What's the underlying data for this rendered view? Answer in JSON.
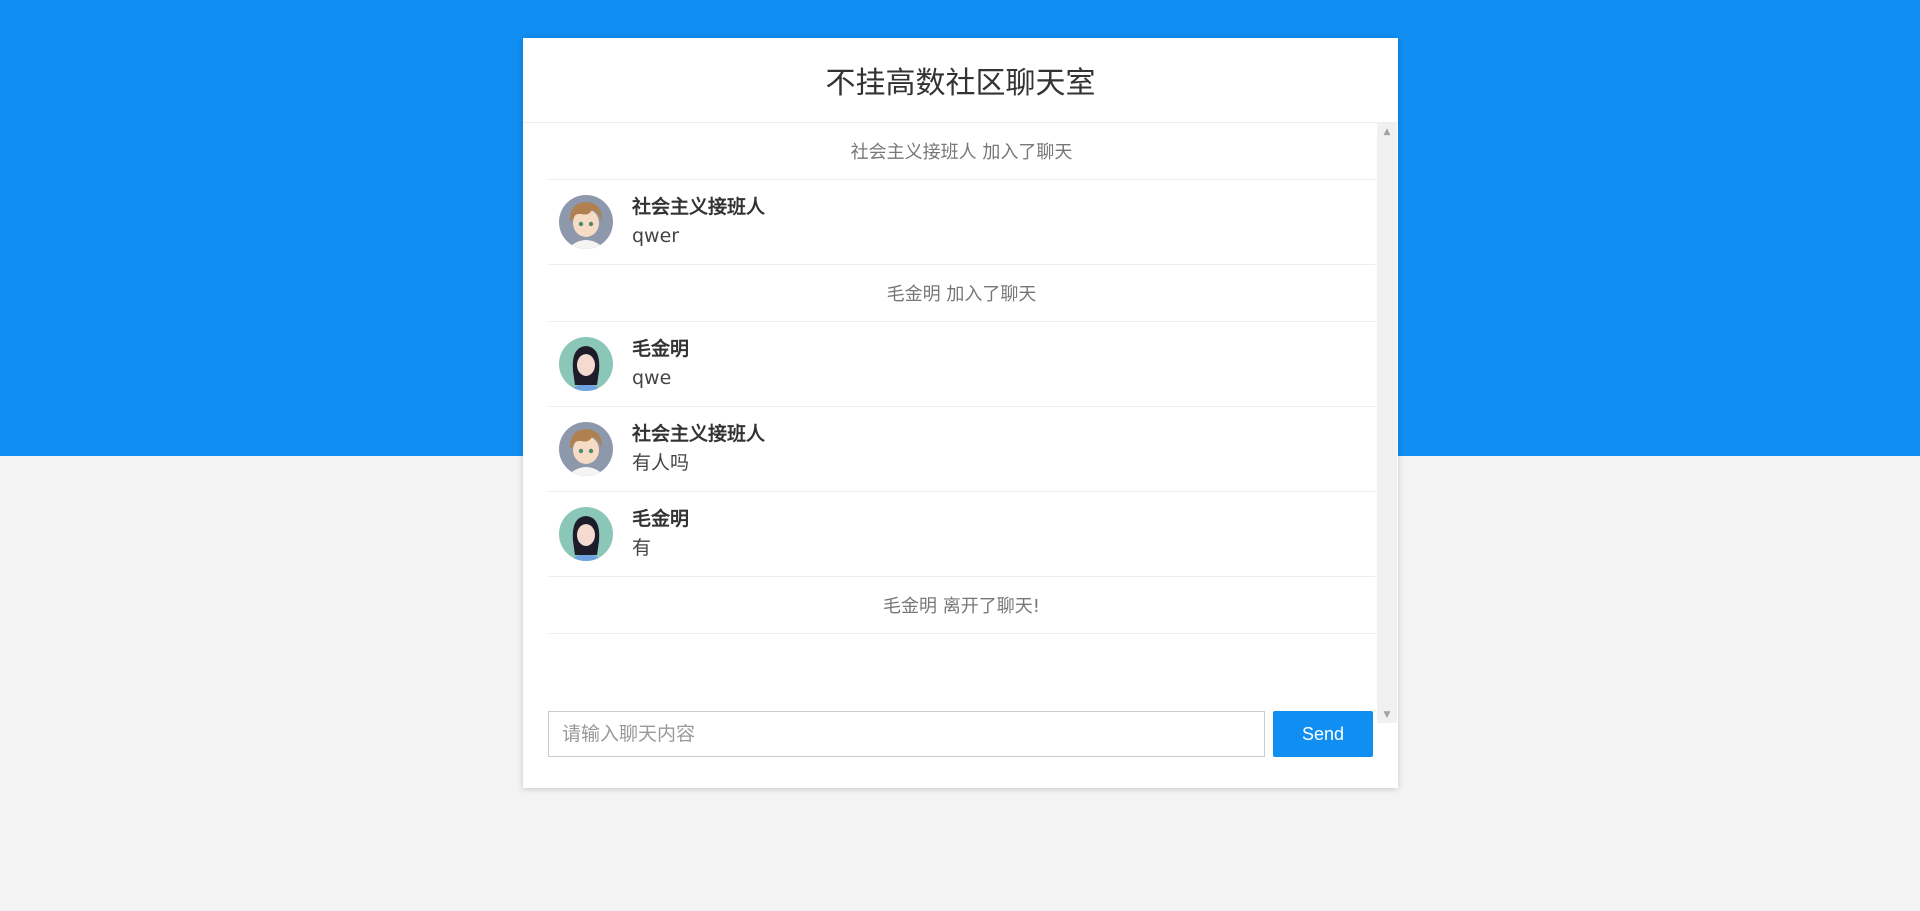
{
  "header": {
    "title": "不挂高数社区聊天室"
  },
  "messages": [
    {
      "kind": "notice",
      "text": "社会主义接班人 加入了聊天"
    },
    {
      "kind": "message",
      "avatar": "anime-boy-avatar",
      "user": "社会主义接班人",
      "text": "qwer"
    },
    {
      "kind": "notice",
      "text": "毛金明 加入了聊天"
    },
    {
      "kind": "message",
      "avatar": "girl-photo-avatar",
      "user": "毛金明",
      "text": "qwe"
    },
    {
      "kind": "message",
      "avatar": "anime-boy-avatar",
      "user": "社会主义接班人",
      "text": "有人吗"
    },
    {
      "kind": "message",
      "avatar": "girl-photo-avatar",
      "user": "毛金明",
      "text": "有"
    },
    {
      "kind": "notice",
      "text": "毛金明 离开了聊天!"
    }
  ],
  "composer": {
    "placeholder": "请输入聊天内容",
    "value": "",
    "send_label": "Send"
  },
  "colors": {
    "accent": "#108ef2",
    "page_background": "#f3f3f3",
    "card_background": "#ffffff"
  }
}
